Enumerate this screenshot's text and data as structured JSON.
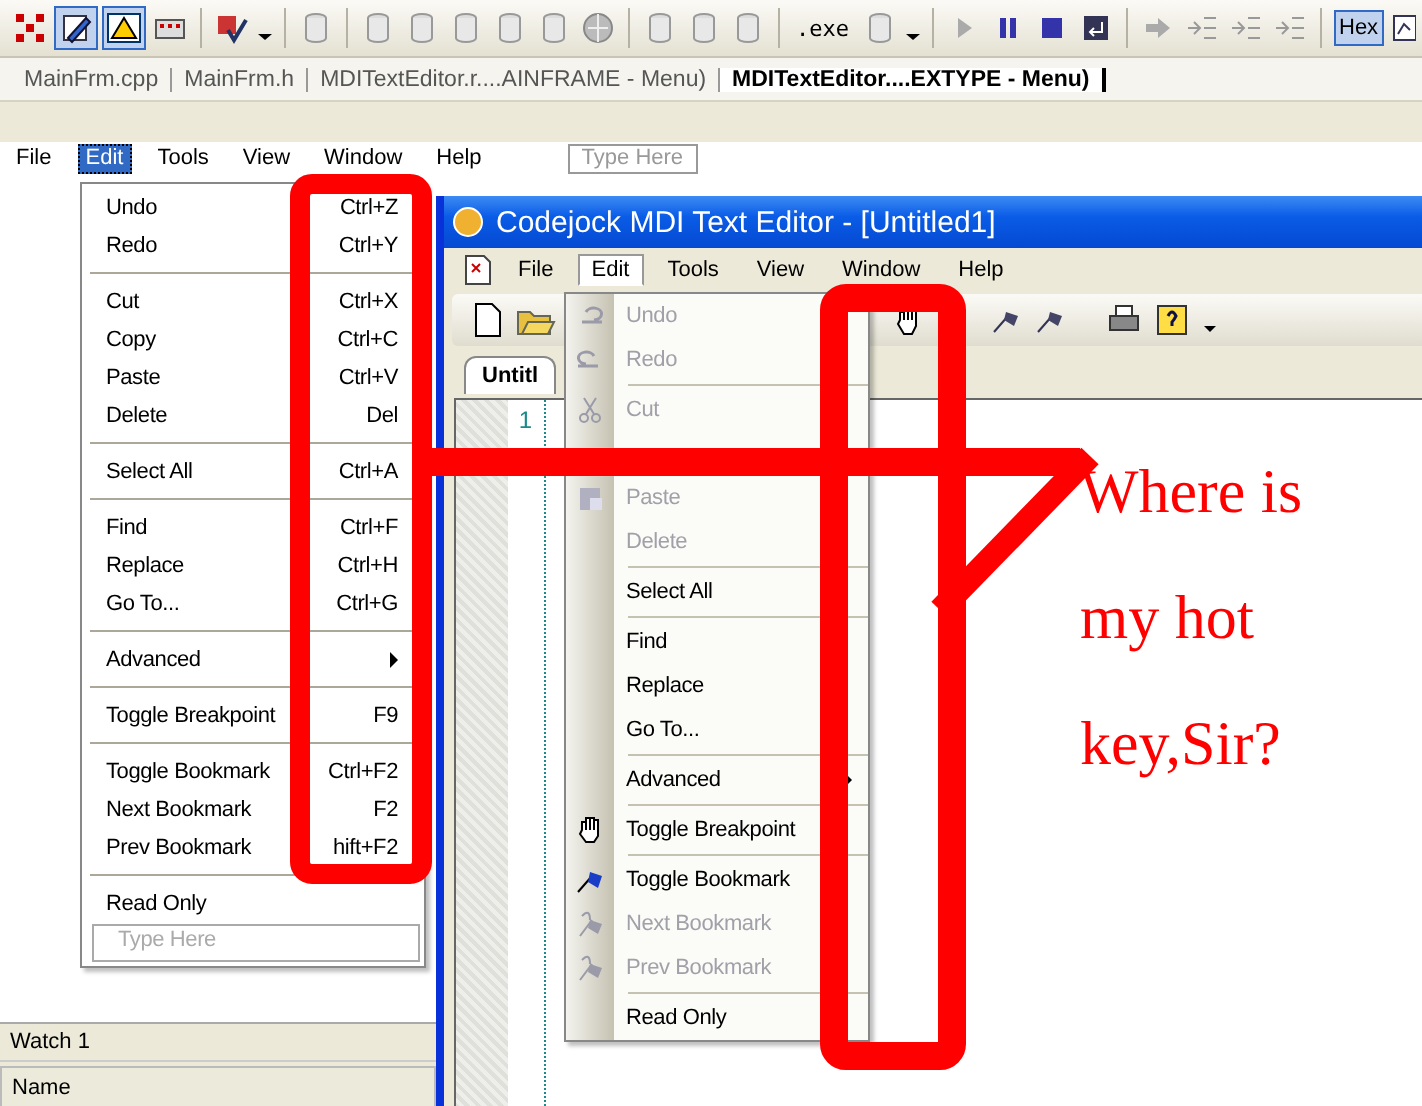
{
  "toolbar": {
    "exe_label": ".exe",
    "hex_label": "Hex",
    "hex_selected": true
  },
  "document_tabs": [
    {
      "label": "MainFrm.cpp",
      "selected": false
    },
    {
      "label": "MainFrm.h",
      "selected": false
    },
    {
      "label": "MDITextEditor.r....AINFRAME - Menu)",
      "selected": false
    },
    {
      "label": "MDITextEditor....EXTYPE - Menu)",
      "selected": true
    }
  ],
  "designer": {
    "menu_bar": [
      {
        "label": "File",
        "selected": false
      },
      {
        "label": "Edit",
        "selected": true
      },
      {
        "label": "Tools",
        "selected": false
      },
      {
        "label": "View",
        "selected": false
      },
      {
        "label": "Window",
        "selected": false
      },
      {
        "label": "Help",
        "selected": false
      }
    ],
    "type_here": "Type Here",
    "edit_menu": [
      {
        "kind": "item",
        "label": "Undo",
        "shortcut": "Ctrl+Z"
      },
      {
        "kind": "item",
        "label": "Redo",
        "shortcut": "Ctrl+Y"
      },
      {
        "kind": "separator"
      },
      {
        "kind": "item",
        "label": "Cut",
        "shortcut": "Ctrl+X"
      },
      {
        "kind": "item",
        "label": "Copy",
        "shortcut": "Ctrl+C"
      },
      {
        "kind": "item",
        "label": "Paste",
        "shortcut": "Ctrl+V"
      },
      {
        "kind": "item",
        "label": "Delete",
        "shortcut": "Del"
      },
      {
        "kind": "separator"
      },
      {
        "kind": "item",
        "label": "Select All",
        "shortcut": "Ctrl+A"
      },
      {
        "kind": "separator"
      },
      {
        "kind": "item",
        "label": "Find",
        "shortcut": "Ctrl+F"
      },
      {
        "kind": "item",
        "label": "Replace",
        "shortcut": "Ctrl+H"
      },
      {
        "kind": "item",
        "label": "Go To...",
        "shortcut": "Ctrl+G"
      },
      {
        "kind": "separator"
      },
      {
        "kind": "submenu",
        "label": "Advanced"
      },
      {
        "kind": "separator"
      },
      {
        "kind": "item",
        "label": "Toggle Breakpoint",
        "shortcut": "F9"
      },
      {
        "kind": "separator"
      },
      {
        "kind": "item",
        "label": "Toggle Bookmark",
        "shortcut": "Ctrl+F2"
      },
      {
        "kind": "item",
        "label": "Next Bookmark",
        "shortcut": "F2"
      },
      {
        "kind": "item",
        "label": "Prev Bookmark",
        "shortcut": "hift+F2"
      },
      {
        "kind": "separator"
      },
      {
        "kind": "item",
        "label": "Read Only"
      },
      {
        "kind": "new",
        "placeholder": "Type Here"
      }
    ]
  },
  "app_window": {
    "title": "Codejock MDI Text Editor - [Untitled1]",
    "menu_bar": [
      {
        "label": "File",
        "selected": false
      },
      {
        "label": "Edit",
        "selected": true
      },
      {
        "label": "Tools",
        "selected": false
      },
      {
        "label": "View",
        "selected": false
      },
      {
        "label": "Window",
        "selected": false
      },
      {
        "label": "Help",
        "selected": false
      }
    ],
    "tab": "Untitl",
    "line_number": "1",
    "edit_menu": [
      {
        "kind": "item",
        "label": "Undo",
        "disabled": true
      },
      {
        "kind": "item",
        "label": "Redo",
        "disabled": true
      },
      {
        "kind": "separator"
      },
      {
        "kind": "item",
        "label": "Cut",
        "disabled": true
      },
      {
        "kind": "covered"
      },
      {
        "kind": "item",
        "label": "Paste",
        "disabled": true
      },
      {
        "kind": "item",
        "label": "Delete",
        "disabled": true
      },
      {
        "kind": "separator"
      },
      {
        "kind": "item",
        "label": "Select All",
        "disabled": false
      },
      {
        "kind": "separator"
      },
      {
        "kind": "item",
        "label": "Find",
        "disabled": false
      },
      {
        "kind": "item",
        "label": "Replace",
        "disabled": false
      },
      {
        "kind": "item",
        "label": "Go To...",
        "disabled": false
      },
      {
        "kind": "separator"
      },
      {
        "kind": "submenu",
        "label": "Advanced",
        "disabled": false
      },
      {
        "kind": "separator"
      },
      {
        "kind": "item",
        "label": "Toggle Breakpoint",
        "disabled": false
      },
      {
        "kind": "separator"
      },
      {
        "kind": "item",
        "label": "Toggle Bookmark",
        "disabled": false
      },
      {
        "kind": "item",
        "label": "Next Bookmark",
        "disabled": true
      },
      {
        "kind": "item",
        "label": "Prev Bookmark",
        "disabled": true
      },
      {
        "kind": "separator"
      },
      {
        "kind": "item",
        "label": "Read Only",
        "disabled": false
      }
    ]
  },
  "watch": {
    "title": "Watch 1",
    "column": "Name"
  },
  "annotation": [
    "Where is",
    "my hot",
    "key,Sir?"
  ]
}
